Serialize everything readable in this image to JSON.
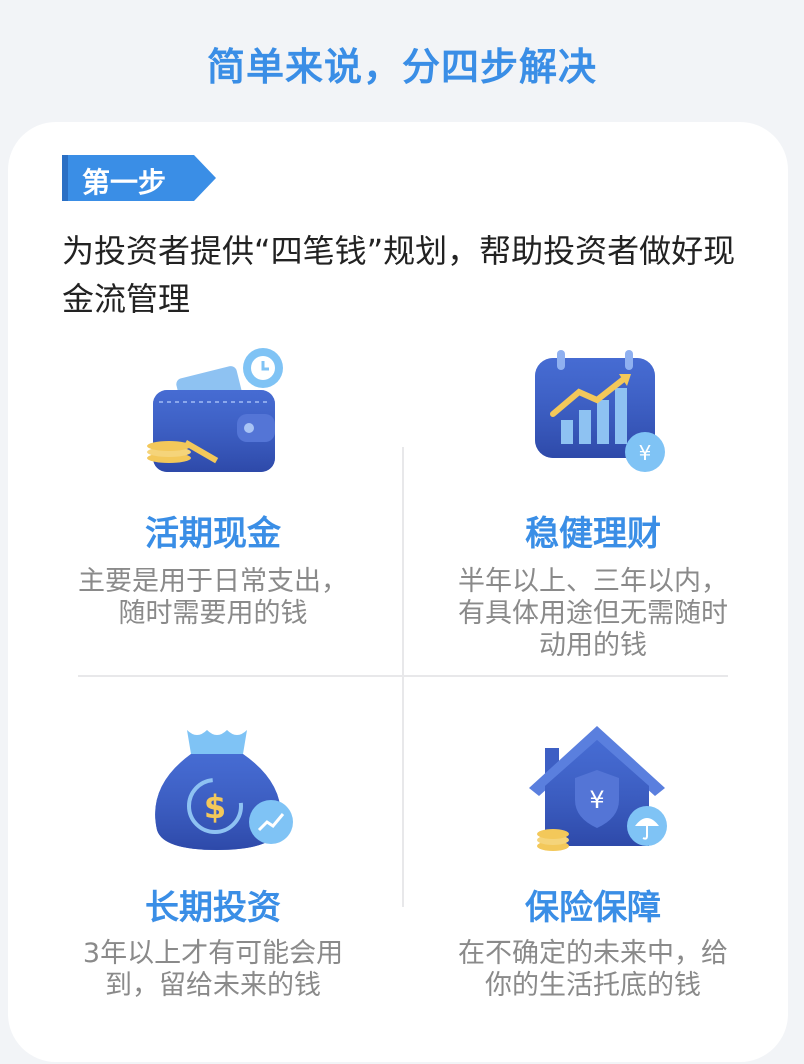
{
  "header": {
    "title": "简单来说，分四步解决"
  },
  "step": {
    "tag": "第一步",
    "description": "为投资者提供“四笔钱”规划，帮助投资者做好现金流管理"
  },
  "items": [
    {
      "icon": "wallet-icon",
      "title": "活期现金",
      "desc": "主要是用于日常支出，随时需要用的钱"
    },
    {
      "icon": "calendar-chart-icon",
      "title": "稳健理财",
      "desc": "半年以上、三年以内，有具体用途但无需随时动用的钱"
    },
    {
      "icon": "money-bag-icon",
      "title": "长期投资",
      "desc": "3年以上才有可能会用到，留给未来的钱"
    },
    {
      "icon": "insured-house-icon",
      "title": "保险保障",
      "desc": "在不确定的未来中，给你的生活托底的钱"
    }
  ],
  "colors": {
    "accent": "#3a8ee6",
    "icon_dark": "#3d5fc4",
    "icon_light": "#7fc3f5",
    "gold": "#f3c85a"
  }
}
